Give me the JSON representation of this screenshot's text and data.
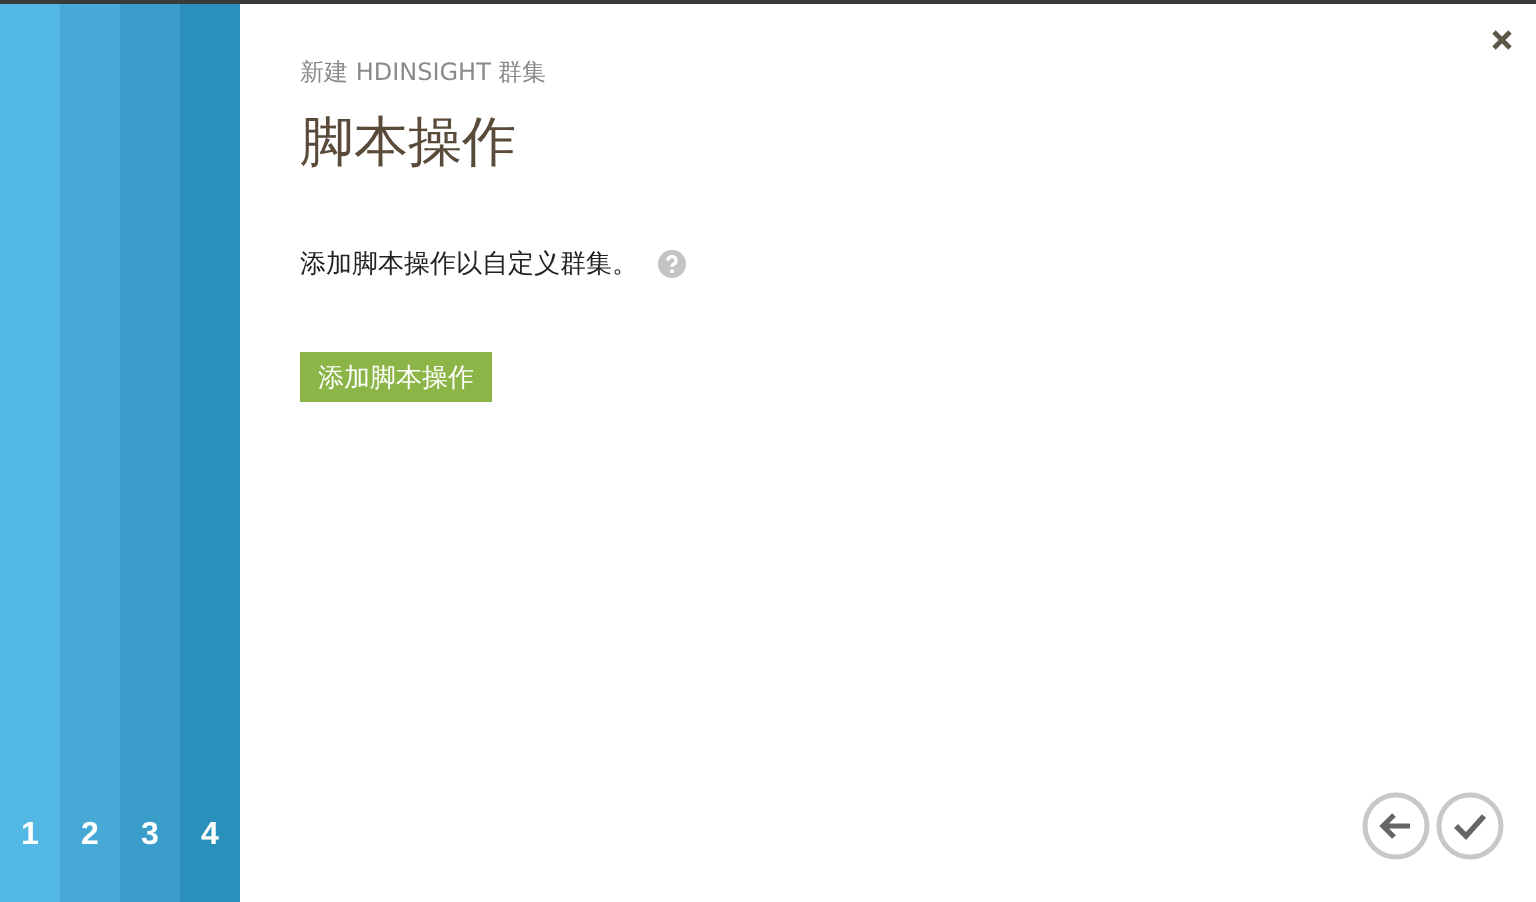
{
  "steps": [
    {
      "label": "1",
      "color": "#52b7e2"
    },
    {
      "label": "2",
      "color": "#47aad6"
    },
    {
      "label": "3",
      "color": "#3b9dca"
    },
    {
      "label": "4",
      "color": "#2b8fbb"
    }
  ],
  "subtitle": "新建 HDINSIGHT 群集",
  "title": "脚本操作",
  "description": "添加脚本操作以自定义群集。",
  "add_button": "添加脚本操作"
}
